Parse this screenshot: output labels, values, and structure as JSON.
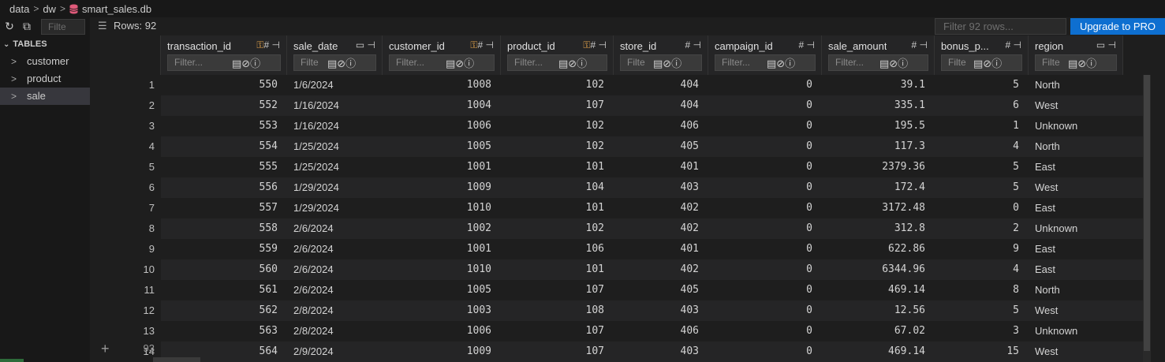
{
  "breadcrumb": {
    "parts": [
      "data",
      "dw",
      "smart_sales.db"
    ]
  },
  "sidebar": {
    "filter_placeholder": "Filte",
    "section_label": "TABLES",
    "tables": [
      "customer",
      "product",
      "sale"
    ],
    "active_table": "sale"
  },
  "toolbar": {
    "rows_label": "Rows: 92",
    "filter_rows_placeholder": "Filter 92 rows...",
    "upgrade_label": "Upgrade to PRO"
  },
  "columns": [
    {
      "name": "transaction_id",
      "filter_placeholder": "Filter...",
      "icons": "🔑# ⊣",
      "align": "num"
    },
    {
      "name": "sale_date",
      "filter_placeholder": "Filte",
      "icons": "▭ ⊣",
      "align": "txt"
    },
    {
      "name": "customer_id",
      "filter_placeholder": "Filter...",
      "icons": "🔑# ⊣",
      "align": "num"
    },
    {
      "name": "product_id",
      "filter_placeholder": "Filter...",
      "icons": "🔑# ⊣",
      "align": "num"
    },
    {
      "name": "store_id",
      "filter_placeholder": "Filte",
      "icons": "# ⊣",
      "align": "num"
    },
    {
      "name": "campaign_id",
      "filter_placeholder": "Filter...",
      "icons": "# ⊣",
      "align": "num"
    },
    {
      "name": "sale_amount",
      "filter_placeholder": "Filter...",
      "icons": "# ⊣",
      "align": "num"
    },
    {
      "name": "bonus_p...",
      "filter_placeholder": "Filte",
      "icons": "# ⊣",
      "align": "num"
    },
    {
      "name": "region",
      "filter_placeholder": "Filte",
      "icons": "▭ ⊣",
      "align": "txt"
    }
  ],
  "rows": [
    {
      "n": "1",
      "c": [
        "550",
        "1/6/2024",
        "1008",
        "102",
        "404",
        "0",
        "39.1",
        "5",
        "North"
      ]
    },
    {
      "n": "2",
      "c": [
        "552",
        "1/16/2024",
        "1004",
        "107",
        "404",
        "0",
        "335.1",
        "6",
        "West"
      ]
    },
    {
      "n": "3",
      "c": [
        "553",
        "1/16/2024",
        "1006",
        "102",
        "406",
        "0",
        "195.5",
        "1",
        "Unknown"
      ]
    },
    {
      "n": "4",
      "c": [
        "554",
        "1/25/2024",
        "1005",
        "102",
        "405",
        "0",
        "117.3",
        "4",
        "North"
      ]
    },
    {
      "n": "5",
      "c": [
        "555",
        "1/25/2024",
        "1001",
        "101",
        "401",
        "0",
        "2379.36",
        "5",
        "East"
      ]
    },
    {
      "n": "6",
      "c": [
        "556",
        "1/29/2024",
        "1009",
        "104",
        "403",
        "0",
        "172.4",
        "5",
        "West"
      ]
    },
    {
      "n": "7",
      "c": [
        "557",
        "1/29/2024",
        "1010",
        "101",
        "402",
        "0",
        "3172.48",
        "0",
        "East"
      ]
    },
    {
      "n": "8",
      "c": [
        "558",
        "2/6/2024",
        "1002",
        "102",
        "402",
        "0",
        "312.8",
        "2",
        "Unknown"
      ]
    },
    {
      "n": "9",
      "c": [
        "559",
        "2/6/2024",
        "1001",
        "106",
        "401",
        "0",
        "622.86",
        "9",
        "East"
      ]
    },
    {
      "n": "10",
      "c": [
        "560",
        "2/6/2024",
        "1010",
        "101",
        "402",
        "0",
        "6344.96",
        "4",
        "East"
      ]
    },
    {
      "n": "11",
      "c": [
        "561",
        "2/6/2024",
        "1005",
        "107",
        "405",
        "0",
        "469.14",
        "8",
        "North"
      ]
    },
    {
      "n": "12",
      "c": [
        "562",
        "2/8/2024",
        "1003",
        "108",
        "403",
        "0",
        "12.56",
        "5",
        "West"
      ]
    },
    {
      "n": "13",
      "c": [
        "563",
        "2/8/2024",
        "1006",
        "107",
        "406",
        "0",
        "67.02",
        "3",
        "Unknown"
      ]
    },
    {
      "n": "14",
      "c": [
        "564",
        "2/9/2024",
        "1009",
        "107",
        "403",
        "0",
        "469.14",
        "15",
        "West"
      ]
    }
  ],
  "add_row_count": "93",
  "colors": {
    "accent": "#0e6fd0",
    "key_icon": "#e5a54a",
    "db_icon": "#e05a7a"
  }
}
